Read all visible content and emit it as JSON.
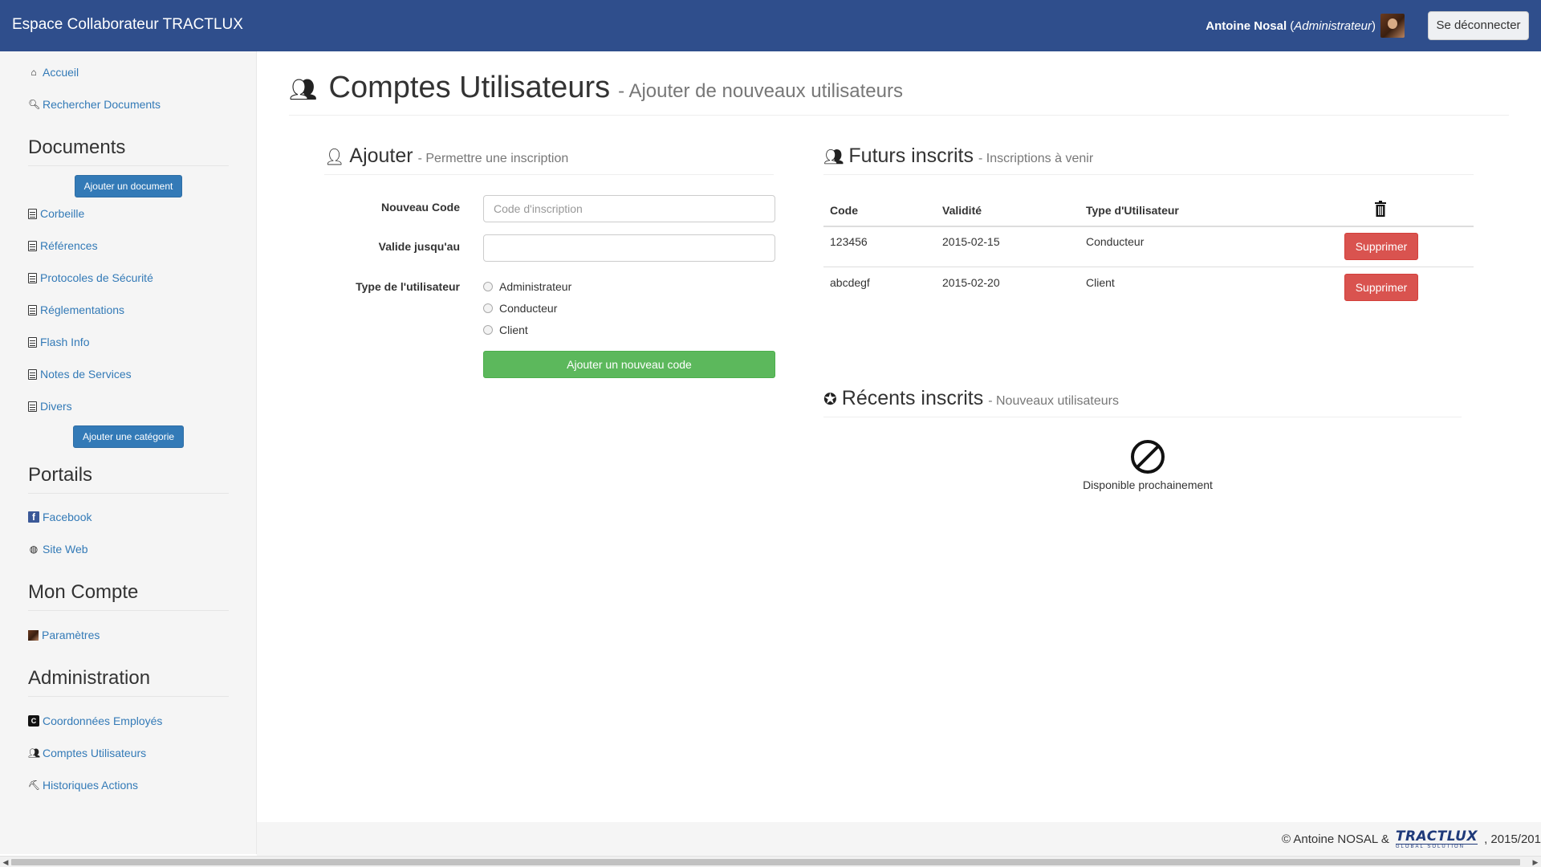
{
  "navbar": {
    "brand": "Espace Collaborateur TRACTLUX",
    "user_name": "Antoine Nosal",
    "user_role_open": "(",
    "user_role": "Administrateur",
    "user_role_close": ")",
    "logout_label": "Se déconnecter",
    "bg_color": "#2f4e8c"
  },
  "sidebar": {
    "home": "Accueil",
    "search": "Rechercher Documents",
    "documents_title": "Documents",
    "add_document": "Ajouter un document",
    "doc_items": [
      "Corbeille",
      "Références",
      "Protocoles de Sécurité",
      "Réglementations",
      "Flash Info",
      "Notes de Services",
      "Divers"
    ],
    "add_category": "Ajouter une catégorie",
    "portals_title": "Portails",
    "facebook": "Facebook",
    "website": "Site Web",
    "account_title": "Mon Compte",
    "settings": "Paramètres",
    "admin_title": "Administration",
    "employees": "Coordonnées Employés",
    "user_accounts": "Comptes Utilisateurs",
    "history": "Historiques Actions"
  },
  "page": {
    "title": "Comptes Utilisateurs",
    "subtitle": "- Ajouter de nouveaux utilisateurs"
  },
  "add_section": {
    "title": "Ajouter",
    "subtitle": "- Permettre une inscription",
    "code_label": "Nouveau Code",
    "code_placeholder": "Code d'inscription",
    "valid_label": "Valide jusqu'au",
    "type_label": "Type de l'utilisateur",
    "types": [
      "Administrateur",
      "Conducteur",
      "Client"
    ],
    "submit_label": "Ajouter un nouveau code"
  },
  "future_section": {
    "title": "Futurs inscrits",
    "subtitle": "- Inscriptions à venir",
    "columns": [
      "Code",
      "Validité",
      "Type d'Utilisateur"
    ],
    "rows": [
      {
        "code": "123456",
        "validity": "2015-02-15",
        "type": "Conducteur",
        "action": "Supprimer"
      },
      {
        "code": "abcdegf",
        "validity": "2015-02-20",
        "type": "Client",
        "action": "Supprimer"
      }
    ]
  },
  "recent_section": {
    "title": "Récents inscrits",
    "subtitle": "- Nouveaux utilisateurs",
    "unavailable_text": "Disponible prochainement"
  },
  "footer": {
    "copyright": "© Antoine NOSAL &",
    "logo_text": "TRACTLUX",
    "logo_sub": "GLOBAL SOLUTION",
    "years": ", 2015/201"
  },
  "icons": [
    "home-icon",
    "search-document-icon",
    "document-icon",
    "facebook-icon",
    "globe-icon",
    "user-thumbnail-icon",
    "contact-card-icon",
    "users-icon",
    "hammer-icon",
    "user-add-icon",
    "trash-icon",
    "ban-icon",
    "verified-icon"
  ]
}
